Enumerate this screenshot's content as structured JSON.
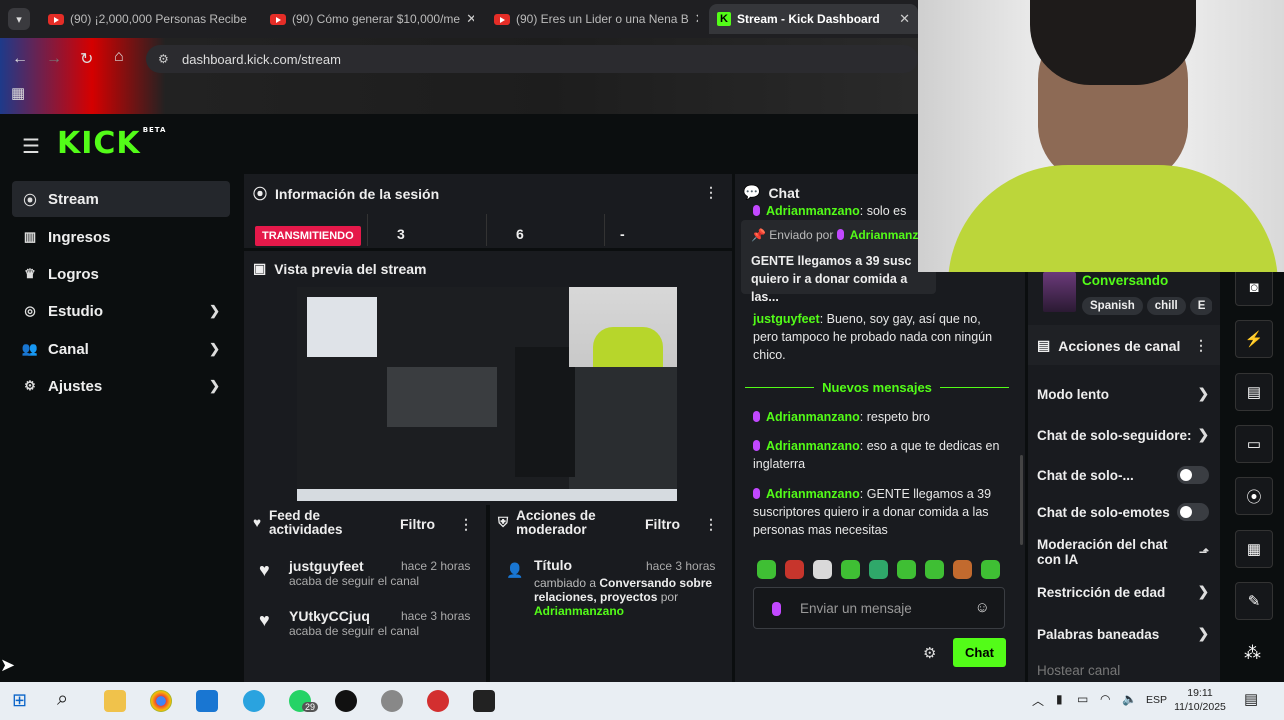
{
  "browser": {
    "tabs": [
      {
        "title": "(90) ¡2,000,000 Personas Recibe"
      },
      {
        "title": "(90) Cómo generar $10,000/me"
      },
      {
        "title": "(90) Eres un Lider o una Nena B"
      },
      {
        "title": "Stream - Kick Dashboard"
      }
    ],
    "url": "dashboard.kick.com/stream"
  },
  "logo": {
    "text": "KICK",
    "badge": "BETA"
  },
  "sidebar": {
    "items": [
      {
        "label": "Stream",
        "icon": "broadcast-icon",
        "selected": true
      },
      {
        "label": "Ingresos",
        "icon": "chart-icon"
      },
      {
        "label": "Logros",
        "icon": "trophy-icon"
      },
      {
        "label": "Estudio",
        "icon": "studio-icon",
        "expandable": true
      },
      {
        "label": "Canal",
        "icon": "users-icon",
        "expandable": true
      },
      {
        "label": "Ajustes",
        "icon": "gear-icon",
        "expandable": true
      }
    ]
  },
  "session": {
    "title": "Información de la sesión",
    "status": "TRANSMITIENDO",
    "stats": [
      "3",
      "6",
      "-"
    ]
  },
  "preview": {
    "title": "Vista previa del stream"
  },
  "feed": {
    "title": "Feed de actividades",
    "filter": "Filtro",
    "items": [
      {
        "user": "justguyfeet",
        "action": "acaba de seguir el canal",
        "time": "hace 2 horas"
      },
      {
        "user": "YUtkyCCjuq",
        "action": "acaba de seguir el canal",
        "time": "hace 3 horas"
      }
    ]
  },
  "moderator": {
    "title": "Acciones de moderador",
    "filter": "Filtro",
    "item": {
      "heading": "Título",
      "time": "hace 3 horas",
      "prefix": "cambiado a",
      "value": "Conversando sobre relaciones, proyectos",
      "by": "por",
      "user": "Adrianmanzano"
    }
  },
  "chat": {
    "title": "Chat",
    "top_partial": {
      "user": "Adrianmanzano",
      "text": "solo es"
    },
    "pinned": {
      "label": "Enviado por",
      "user": "Adrianmanzano",
      "text": "GENTE llegamos a 39 susc quiero ir a donar comida a las..."
    },
    "messages": [
      {
        "user": "justguyfeet",
        "text": "Bueno, soy gay, así que no, pero tampoco he probado nada con ningún chico."
      }
    ],
    "new_label": "Nuevos mensajes",
    "new_messages": [
      {
        "user": "Adrianmanzano",
        "text": "respeto bro"
      },
      {
        "user": "Adrianmanzano",
        "text": "eso a que te dedicas en inglaterra"
      },
      {
        "user": "Adrianmanzano",
        "text": "GENTE llegamos a 39 suscriptores quiero ir a donar comida a las personas mas necesitas"
      }
    ],
    "input_placeholder": "Enviar un mensaje",
    "send_label": "Chat"
  },
  "channel": {
    "category": "Conversando",
    "tags": [
      "Spanish",
      "chill"
    ],
    "actions_title": "Acciones de canal",
    "actions": [
      {
        "label": "Modo lento",
        "control": "chevron"
      },
      {
        "label": "Chat de solo-seguidore:",
        "control": "chevron"
      },
      {
        "label": "Chat de solo-...",
        "control": "toggle"
      },
      {
        "label": "Chat de solo-emotes",
        "control": "toggle"
      },
      {
        "label": "Moderación del chat con IA",
        "control": "chart"
      },
      {
        "label": "Restricción de edad",
        "control": "chevron"
      },
      {
        "label": "Palabras baneadas",
        "control": "chevron"
      },
      {
        "label": "Hostear canal",
        "control": "none"
      }
    ]
  },
  "taskbar": {
    "whatsapp_badge": "29",
    "language": "ESP",
    "time": "19:11",
    "date": "11/10/2025"
  },
  "colors": {
    "accent": "#53fc18",
    "live": "#e5194a",
    "mic": "#c248ff"
  }
}
